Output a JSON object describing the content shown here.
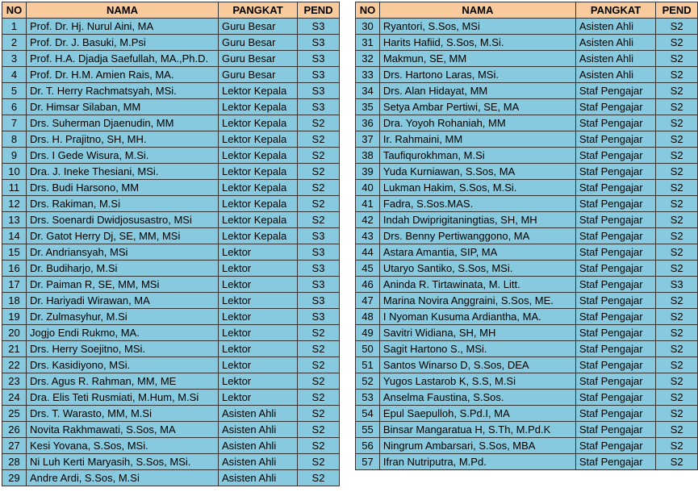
{
  "headers": {
    "no": "NO",
    "nama": "NAMA",
    "pangkat": "PANGKAT",
    "pend": "PEND"
  },
  "left_rows": [
    {
      "no": "1",
      "nama": "Prof. Dr. Hj. Nurul Aini, MA",
      "pangkat": "Guru Besar",
      "pend": "S3"
    },
    {
      "no": "2",
      "nama": "Prof. Dr. J. Basuki, M.Psi",
      "pangkat": "Guru Besar",
      "pend": "S3"
    },
    {
      "no": "3",
      "nama": "Prof. H.A. Djadja Saefullah, MA.,Ph.D.",
      "pangkat": "Guru Besar",
      "pend": "S3"
    },
    {
      "no": "4",
      "nama": "Prof. Dr. H.M. Amien Rais, MA.",
      "pangkat": "Guru Besar",
      "pend": "S3"
    },
    {
      "no": "5",
      "nama": "Dr. T. Herry Rachmatsyah, MSi.",
      "pangkat": "Lektor Kepala",
      "pend": "S3"
    },
    {
      "no": "6",
      "nama": "Dr. Himsar Silaban, MM",
      "pangkat": "Lektor Kepala",
      "pend": "S3"
    },
    {
      "no": "7",
      "nama": "Drs. Suherman Djaenudin, MM",
      "pangkat": "Lektor Kepala",
      "pend": "S2"
    },
    {
      "no": "8",
      "nama": "Drs. H. Prajitno, SH, MH.",
      "pangkat": "Lektor Kepala",
      "pend": "S2"
    },
    {
      "no": "9",
      "nama": "Drs. I Gede Wisura, M.Si.",
      "pangkat": "Lektor Kepala",
      "pend": "S2"
    },
    {
      "no": "10",
      "nama": "Dra. J. Ineke Thesiani, MSi.",
      "pangkat": "Lektor Kepala",
      "pend": "S2"
    },
    {
      "no": "11",
      "nama": "Drs. Budi Harsono, MM",
      "pangkat": "Lektor Kepala",
      "pend": "S2"
    },
    {
      "no": "12",
      "nama": "Drs. Rakiman, M.Si",
      "pangkat": "Lektor Kepala",
      "pend": "S2"
    },
    {
      "no": "13",
      "nama": "Drs. Soenardi Dwidjosusastro, MSi",
      "pangkat": "Lektor Kepala",
      "pend": "S2"
    },
    {
      "no": "14",
      "nama": "Dr. Gatot Herry Dj, SE, MM, MSi",
      "pangkat": "Lektor Kepala",
      "pend": "S3"
    },
    {
      "no": "15",
      "nama": "Dr. Andriansyah, MSi",
      "pangkat": "Lektor",
      "pend": "S3"
    },
    {
      "no": "16",
      "nama": "Dr. Budiharjo, M.Si",
      "pangkat": "Lektor",
      "pend": "S3"
    },
    {
      "no": "17",
      "nama": "Dr. Paiman R, SE, MM, MSi",
      "pangkat": "Lektor",
      "pend": "S3"
    },
    {
      "no": "18",
      "nama": "Dr. Hariyadi Wirawan, MA",
      "pangkat": "Lektor",
      "pend": "S3"
    },
    {
      "no": "19",
      "nama": "Dr. Zulmasyhur, M.Si",
      "pangkat": "Lektor",
      "pend": "S3"
    },
    {
      "no": "20",
      "nama": "Jogjo Endi Rukmo, MA.",
      "pangkat": "Lektor",
      "pend": "S2"
    },
    {
      "no": "21",
      "nama": "Drs. Herry Soejitno, MSi.",
      "pangkat": "Lektor",
      "pend": "S2"
    },
    {
      "no": "22",
      "nama": "Drs. Kasidiyono, MSi.",
      "pangkat": "Lektor",
      "pend": "S2"
    },
    {
      "no": "23",
      "nama": "Drs. Agus R. Rahman, MM, ME",
      "pangkat": "Lektor",
      "pend": "S2"
    },
    {
      "no": "24",
      "nama": "Dra. Elis Teti Rusmiati, M.Hum, M.Si",
      "pangkat": "Lektor",
      "pend": "S2"
    },
    {
      "no": "25",
      "nama": "Drs. T. Warasto, MM, M.Si",
      "pangkat": "Asisten Ahli",
      "pend": "S2"
    },
    {
      "no": "26",
      "nama": "Novita Rakhmawati, S.Sos, MA",
      "pangkat": "Asisten Ahli",
      "pend": "S2"
    },
    {
      "no": "27",
      "nama": "Kesi Yovana, S.Sos, MSi.",
      "pangkat": "Asisten Ahli",
      "pend": "S2"
    },
    {
      "no": "28",
      "nama": "Ni Luh Kerti Maryasih, S.Sos, MSi.",
      "pangkat": "Asisten Ahli",
      "pend": "S2"
    },
    {
      "no": "29",
      "nama": "Andre Ardi, S.Sos, M.Si",
      "pangkat": "Asisten Ahli",
      "pend": "S2"
    }
  ],
  "right_rows": [
    {
      "no": "30",
      "nama": "Ryantori, S.Sos, MSi",
      "pangkat": "Asisten Ahli",
      "pend": "S2"
    },
    {
      "no": "31",
      "nama": "Harits Hafiid, S.Sos, M.Si.",
      "pangkat": "Asisten Ahli",
      "pend": "S2"
    },
    {
      "no": "32",
      "nama": "Makmun, SE, MM",
      "pangkat": "Asisten Ahli",
      "pend": "S2"
    },
    {
      "no": "33",
      "nama": "Drs. Hartono Laras, MSi.",
      "pangkat": "Asisten Ahli",
      "pend": "S2"
    },
    {
      "no": "34",
      "nama": "Drs. Alan Hidayat, MM",
      "pangkat": "Staf Pengajar",
      "pend": "S2"
    },
    {
      "no": "35",
      "nama": "Setya Ambar Pertiwi, SE, MA",
      "pangkat": "Staf Pengajar",
      "pend": "S2"
    },
    {
      "no": "36",
      "nama": "Dra. Yoyoh Rohaniah, MM",
      "pangkat": "Staf Pengajar",
      "pend": "S2"
    },
    {
      "no": "37",
      "nama": "Ir. Rahmaini, MM",
      "pangkat": "Staf Pengajar",
      "pend": "S2"
    },
    {
      "no": "38",
      "nama": "Taufiqurokhman, M.Si",
      "pangkat": "Staf Pengajar",
      "pend": "S2"
    },
    {
      "no": "39",
      "nama": "Yuda Kurniawan, S.Sos, MA",
      "pangkat": "Staf Pengajar",
      "pend": "S2"
    },
    {
      "no": "40",
      "nama": "Lukman Hakim, S.Sos, M.Si.",
      "pangkat": "Staf Pengajar",
      "pend": "S2"
    },
    {
      "no": "41",
      "nama": "Fadra, S.Sos.MAS.",
      "pangkat": "Staf Pengajar",
      "pend": "S2"
    },
    {
      "no": "42",
      "nama": "Indah Dwiprigitaningtias, SH, MH",
      "pangkat": "Staf Pengajar",
      "pend": "S2"
    },
    {
      "no": "43",
      "nama": "Drs. Benny Pertiwanggono, MA",
      "pangkat": "Staf Pengajar",
      "pend": "S2"
    },
    {
      "no": "44",
      "nama": "Astara Amantia, SIP, MA",
      "pangkat": "Staf Pengajar",
      "pend": "S2"
    },
    {
      "no": "45",
      "nama": "Utaryo Santiko, S.Sos, MSi.",
      "pangkat": "Staf Pengajar",
      "pend": "S2"
    },
    {
      "no": "46",
      "nama": "Aninda R. Tirtawinata, M. Litt.",
      "pangkat": "Staf Pengajar",
      "pend": "S3"
    },
    {
      "no": "47",
      "nama": "Marina Novira Anggraini, S.Sos, ME.",
      "pangkat": "Staf Pengajar",
      "pend": "S2"
    },
    {
      "no": "48",
      "nama": "I Nyoman Kusuma Ardiantha, MA.",
      "pangkat": "Staf Pengajar",
      "pend": "S2"
    },
    {
      "no": "49",
      "nama": "Savitri Widiana, SH, MH",
      "pangkat": "Staf Pengajar",
      "pend": "S2"
    },
    {
      "no": "50",
      "nama": "Sagit Hartono S., MSi.",
      "pangkat": "Staf Pengajar",
      "pend": "S2"
    },
    {
      "no": "51",
      "nama": "Santos Winarso D, S.Sos, DEA",
      "pangkat": "Staf Pengajar",
      "pend": "S2"
    },
    {
      "no": "52",
      "nama": "Yugos Lastarob K, S.S, M.Si",
      "pangkat": "Staf Pengajar",
      "pend": "S2"
    },
    {
      "no": "53",
      "nama": "Anselma Faustina, S.Sos.",
      "pangkat": "Staf Pengajar",
      "pend": "S2"
    },
    {
      "no": "54",
      "nama": "Epul Saepulloh, S.Pd.I, MA",
      "pangkat": "Staf Pengajar",
      "pend": "S2"
    },
    {
      "no": "55",
      "nama": "Binsar Mangaratua H, S.Th, M.Pd.K",
      "pangkat": "Staf Pengajar",
      "pend": "S2"
    },
    {
      "no": "56",
      "nama": "Ningrum Ambarsari, S.Sos, MBA",
      "pangkat": "Staf Pengajar",
      "pend": "S2"
    },
    {
      "no": "57",
      "nama": "Ifran Nutriputra, M.Pd.",
      "pangkat": "Staf Pengajar",
      "pend": "S2"
    }
  ]
}
